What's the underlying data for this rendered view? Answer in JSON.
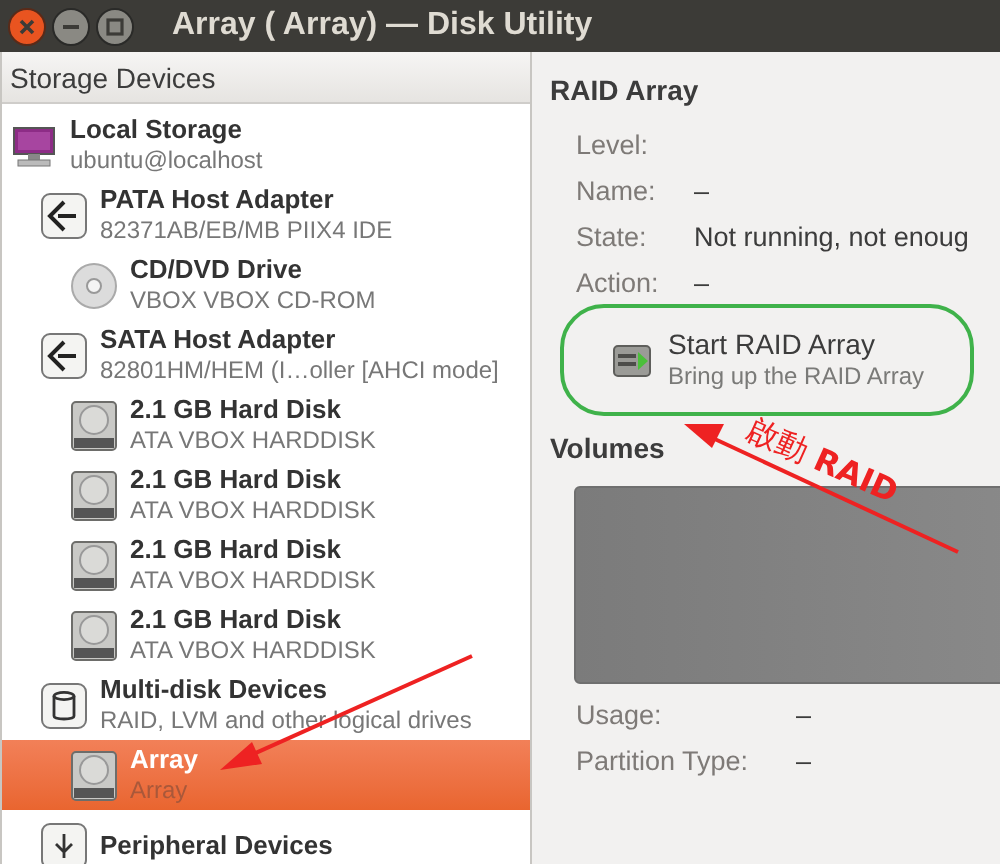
{
  "window": {
    "title": "Array ( Array) — Disk Utility"
  },
  "sidebar": {
    "header": "Storage Devices",
    "items": [
      {
        "kind": "computer",
        "title": "Local Storage",
        "subtitle": "ubuntu@localhost",
        "selected": false,
        "children": [
          {
            "kind": "adapter",
            "title": "PATA Host Adapter",
            "subtitle": "82371AB/EB/MB PIIX4 IDE",
            "selected": false,
            "children": [
              {
                "kind": "optical",
                "title": "CD/DVD Drive",
                "subtitle": "VBOX VBOX CD-ROM",
                "selected": false
              }
            ]
          },
          {
            "kind": "adapter",
            "title": "SATA Host Adapter",
            "subtitle": "82801HM/HEM (I…oller [AHCI mode]",
            "selected": false,
            "children": [
              {
                "kind": "disk",
                "title": "2.1 GB Hard Disk",
                "subtitle": "ATA VBOX HARDDISK",
                "selected": false
              },
              {
                "kind": "disk",
                "title": "2.1 GB Hard Disk",
                "subtitle": "ATA VBOX HARDDISK",
                "selected": false
              },
              {
                "kind": "disk",
                "title": "2.1 GB Hard Disk",
                "subtitle": "ATA VBOX HARDDISK",
                "selected": false
              },
              {
                "kind": "disk",
                "title": "2.1 GB Hard Disk",
                "subtitle": "ATA VBOX HARDDISK",
                "selected": false
              }
            ]
          },
          {
            "kind": "multidisk",
            "title": "Multi-disk Devices",
            "subtitle": "RAID, LVM and other logical drives",
            "selected": false,
            "children": [
              {
                "kind": "disk",
                "title": "Array",
                "subtitle": "Array",
                "selected": true
              }
            ]
          },
          {
            "kind": "peripheral",
            "title": "Peripheral Devices",
            "selected": false
          }
        ]
      }
    ]
  },
  "raid": {
    "heading": "RAID Array",
    "fields": [
      {
        "label": "Level:"
      },
      {
        "label": "Name:",
        "value": "–"
      },
      {
        "label": "State:",
        "value": "Not running, not enoug"
      },
      {
        "label": "Action:",
        "value": "–"
      }
    ],
    "action": {
      "title": "Start RAID Array",
      "subtitle": "Bring up the RAID Array"
    }
  },
  "volumes": {
    "heading": "Volumes",
    "fields": [
      {
        "label": "Usage:",
        "value": "–"
      },
      {
        "label": "Partition Type:",
        "value": "–"
      }
    ]
  },
  "annotation": {
    "text": "啟動 **RAID**"
  }
}
